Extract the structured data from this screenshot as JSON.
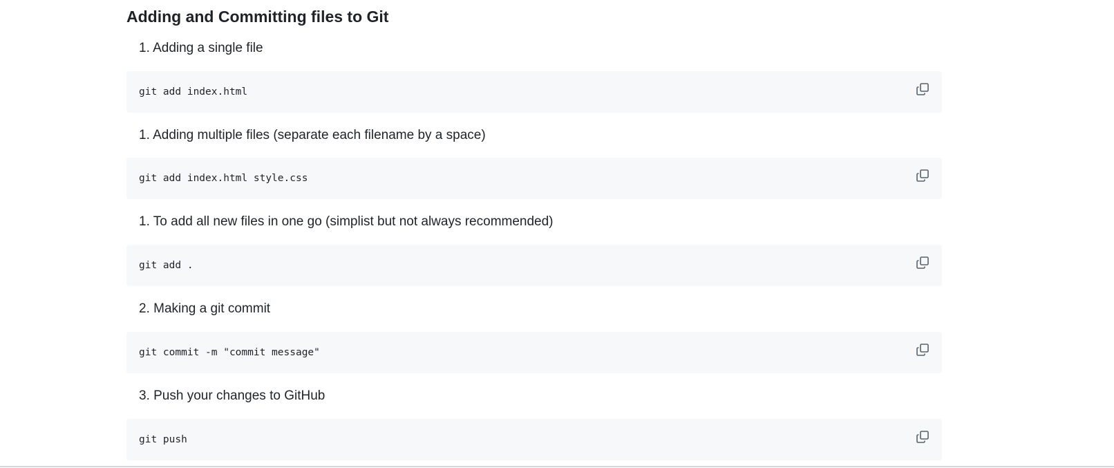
{
  "heading": "Adding and Committing files to Git",
  "steps": [
    {
      "label": "1. Adding a single file",
      "code": "git add index.html"
    },
    {
      "label": "1. Adding multiple files (separate each filename by a space)",
      "code": "git add index.html style.css"
    },
    {
      "label": "1. To add all new files in one go (simplist but not always recommended)",
      "code": "git add ."
    },
    {
      "label": "2. Making a git commit",
      "code": "git commit -m \"commit message\""
    },
    {
      "label": "3. Push your changes to GitHub",
      "code": "git push"
    }
  ],
  "icons": {
    "copy": "copy-icon"
  },
  "colors": {
    "code_background": "#f6f8fa",
    "text": "#1f2328",
    "icon": "#57606a"
  }
}
